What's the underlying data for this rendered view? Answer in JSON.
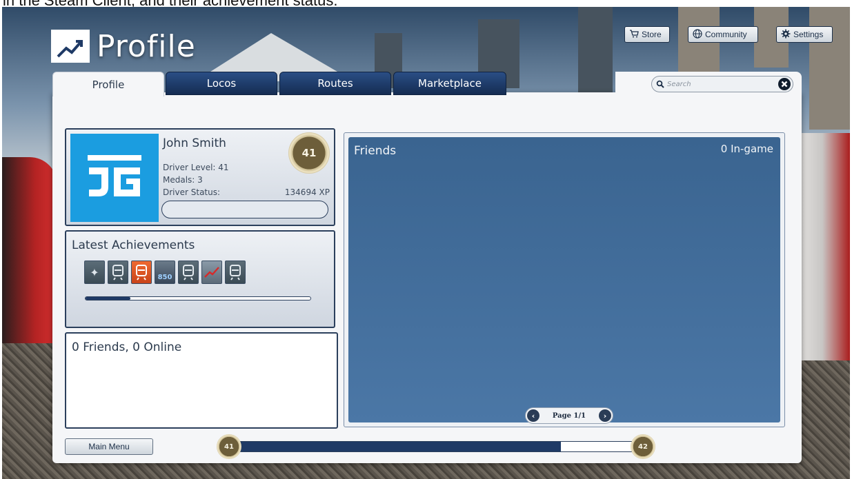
{
  "caption": {
    "text": "in the Steam Client, and their achievement status."
  },
  "header": {
    "title": "Profile",
    "buttons": [
      {
        "label": "Store",
        "icon": "cart-icon"
      },
      {
        "label": "Community",
        "icon": "globe-icon"
      },
      {
        "label": "Settings",
        "icon": "gear-icon"
      }
    ]
  },
  "tabs": [
    {
      "label": "Profile",
      "active": true
    },
    {
      "label": "Locos",
      "active": false
    },
    {
      "label": "Routes",
      "active": false
    },
    {
      "label": "Marketplace",
      "active": false
    }
  ],
  "search": {
    "placeholder": "Search"
  },
  "profile": {
    "name": "John Smith",
    "driver_level": "Driver Level: 41",
    "medals": "Medals: 3",
    "driver_status": "Driver Status:",
    "xp": "134694 XP",
    "level_badge": "41",
    "avatar_text": "JG"
  },
  "achievements": {
    "title": "Latest Achievements",
    "badge_850": "850",
    "icons": [
      "wrench-achievement-icon",
      "train-achievement-icon",
      "train-achievement-icon-active",
      "medal-850-achievement-icon",
      "train-achievement-icon",
      "chart-achievement-icon",
      "train-achievement-icon"
    ],
    "progress_fraction": 0.2
  },
  "friends": {
    "count_text": "0 Friends, 0 Online",
    "title": "Friends",
    "in_game": "0 In-game",
    "page": "Page 1/1"
  },
  "footer": {
    "main_menu": "Main Menu",
    "level_start": "41",
    "level_end": "42",
    "level_progress_fraction": 0.8
  },
  "colors": {
    "accent": "#1f3a66",
    "avatar_bg": "#1b9de0",
    "friends_bg": "#3a6490",
    "active_achievement": "#e0541f"
  }
}
